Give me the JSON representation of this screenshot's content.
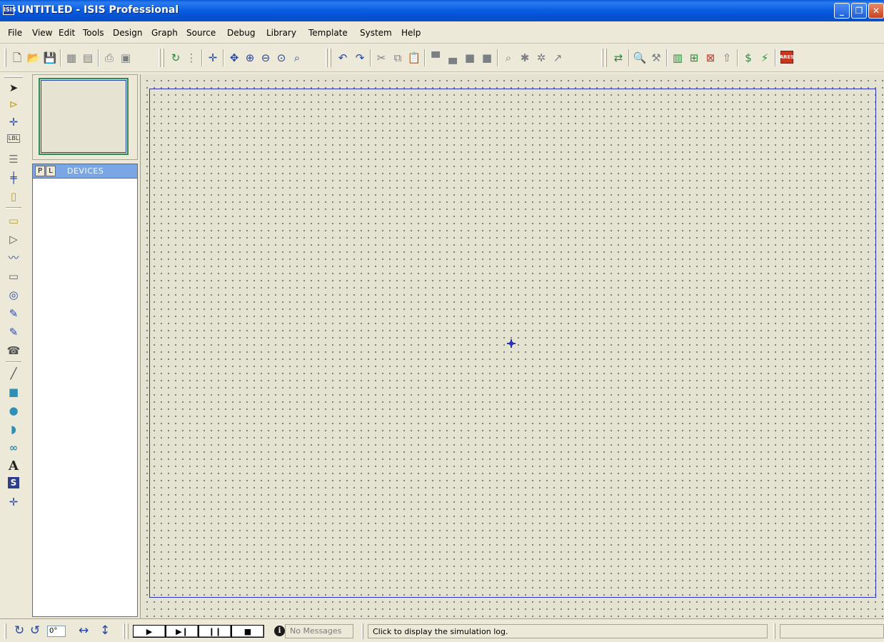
{
  "window": {
    "title": "UNTITLED - ISIS Professional",
    "logo_text": "ISIS",
    "minimize_glyph": "_",
    "maximize_glyph": "❐",
    "close_glyph": "✕"
  },
  "menu": {
    "items": [
      "File",
      "View",
      "Edit",
      "Tools",
      "Design",
      "Graph",
      "Source",
      "Debug",
      "Library",
      "Template",
      "System",
      "Help"
    ]
  },
  "toolbar": {
    "icons": [
      {
        "name": "new-file-icon",
        "glyph": "🗋"
      },
      {
        "name": "open-folder-icon",
        "glyph": "📂"
      },
      {
        "name": "save-icon",
        "glyph": "💾"
      },
      {
        "name": "import-section-icon",
        "glyph": "▦"
      },
      {
        "name": "export-section-icon",
        "glyph": "▤"
      },
      {
        "name": "print-icon",
        "glyph": "⎙"
      },
      {
        "name": "print-area-icon",
        "glyph": "▣"
      },
      {
        "name": "refresh-icon",
        "glyph": "↻"
      },
      {
        "name": "toggle-grid-icon",
        "glyph": "⋮"
      },
      {
        "name": "origin-icon",
        "glyph": "✛"
      },
      {
        "name": "pan-icon",
        "glyph": "✥"
      },
      {
        "name": "zoom-in-icon",
        "glyph": "⊕"
      },
      {
        "name": "zoom-out-icon",
        "glyph": "⊖"
      },
      {
        "name": "zoom-all-icon",
        "glyph": "⊙"
      },
      {
        "name": "zoom-area-icon",
        "glyph": "⌕"
      },
      {
        "name": "undo-icon",
        "glyph": "↶"
      },
      {
        "name": "redo-icon",
        "glyph": "↷"
      },
      {
        "name": "cut-icon",
        "glyph": "✂"
      },
      {
        "name": "copy-icon",
        "glyph": "⧉"
      },
      {
        "name": "paste-icon",
        "glyph": "📋"
      },
      {
        "name": "block-copy-icon",
        "glyph": "▀"
      },
      {
        "name": "block-move-icon",
        "glyph": "▄"
      },
      {
        "name": "block-rotate-icon",
        "glyph": "■"
      },
      {
        "name": "block-delete-icon",
        "glyph": "■"
      },
      {
        "name": "pick-device-icon",
        "glyph": "⌕"
      },
      {
        "name": "make-device-icon",
        "glyph": "✱"
      },
      {
        "name": "packaging-tool-icon",
        "glyph": "✲"
      },
      {
        "name": "decompose-icon",
        "glyph": "↗"
      },
      {
        "name": "wire-autorouter-icon",
        "glyph": "⇄"
      },
      {
        "name": "search-tag-icon",
        "glyph": "🔍"
      },
      {
        "name": "property-assignment-icon",
        "glyph": "⚒"
      },
      {
        "name": "design-explorer-icon",
        "glyph": "▥"
      },
      {
        "name": "new-sheet-icon",
        "glyph": "⊞"
      },
      {
        "name": "remove-sheet-icon",
        "glyph": "⊠"
      },
      {
        "name": "exit-to-parent-icon",
        "glyph": "⇧"
      },
      {
        "name": "bill-of-materials-icon",
        "glyph": "$"
      },
      {
        "name": "electrical-rules-check-icon",
        "glyph": "⚡"
      },
      {
        "name": "ares-icon",
        "glyph": "ARES"
      }
    ]
  },
  "left_tools": {
    "icons": [
      {
        "name": "selection-mode-icon",
        "glyph": "➤"
      },
      {
        "name": "component-mode-icon",
        "glyph": "⊳"
      },
      {
        "name": "junction-dot-icon",
        "glyph": "✛"
      },
      {
        "name": "wire-label-icon",
        "glyph": "LBL"
      },
      {
        "name": "text-script-icon",
        "glyph": "☰"
      },
      {
        "name": "buses-icon",
        "glyph": "╪"
      },
      {
        "name": "subcircuit-icon",
        "glyph": "▯"
      },
      {
        "name": "terminals-icon",
        "glyph": "▭"
      },
      {
        "name": "device-pins-icon",
        "glyph": "▷"
      },
      {
        "name": "graph-icon",
        "glyph": "〰"
      },
      {
        "name": "tape-recorder-icon",
        "glyph": "▭"
      },
      {
        "name": "generator-icon",
        "glyph": "◎"
      },
      {
        "name": "voltage-probe-icon",
        "glyph": "✎"
      },
      {
        "name": "current-probe-icon",
        "glyph": "✎"
      },
      {
        "name": "virtual-instruments-icon",
        "glyph": "☎"
      },
      {
        "name": "line-2d-icon",
        "glyph": "╱"
      },
      {
        "name": "box-2d-icon",
        "glyph": "■"
      },
      {
        "name": "circle-2d-icon",
        "glyph": "●"
      },
      {
        "name": "arc-2d-icon",
        "glyph": "◗"
      },
      {
        "name": "path-2d-icon",
        "glyph": "∞"
      },
      {
        "name": "text-2d-icon",
        "glyph": "A"
      },
      {
        "name": "symbol-2d-icon",
        "glyph": "S"
      },
      {
        "name": "marker-2d-icon",
        "glyph": "✛"
      }
    ]
  },
  "devices_panel": {
    "pick_button": "P",
    "library_button": "L",
    "title": "DEVICES",
    "items": []
  },
  "status": {
    "rotate_cw_glyph": "↻",
    "rotate_ccw_glyph": "↺",
    "rotation_value": "0°",
    "mirror_h_glyph": "↔",
    "mirror_v_glyph": "↕",
    "sim_buttons": [
      {
        "name": "play-button",
        "glyph": "▶"
      },
      {
        "name": "step-button",
        "glyph": "▶❙"
      },
      {
        "name": "pause-button",
        "glyph": "❙❙"
      },
      {
        "name": "stop-button",
        "glyph": "■"
      }
    ],
    "messages_glyph": "i",
    "messages_text": "No Messages",
    "log_text": "Click to display the simulation log."
  }
}
